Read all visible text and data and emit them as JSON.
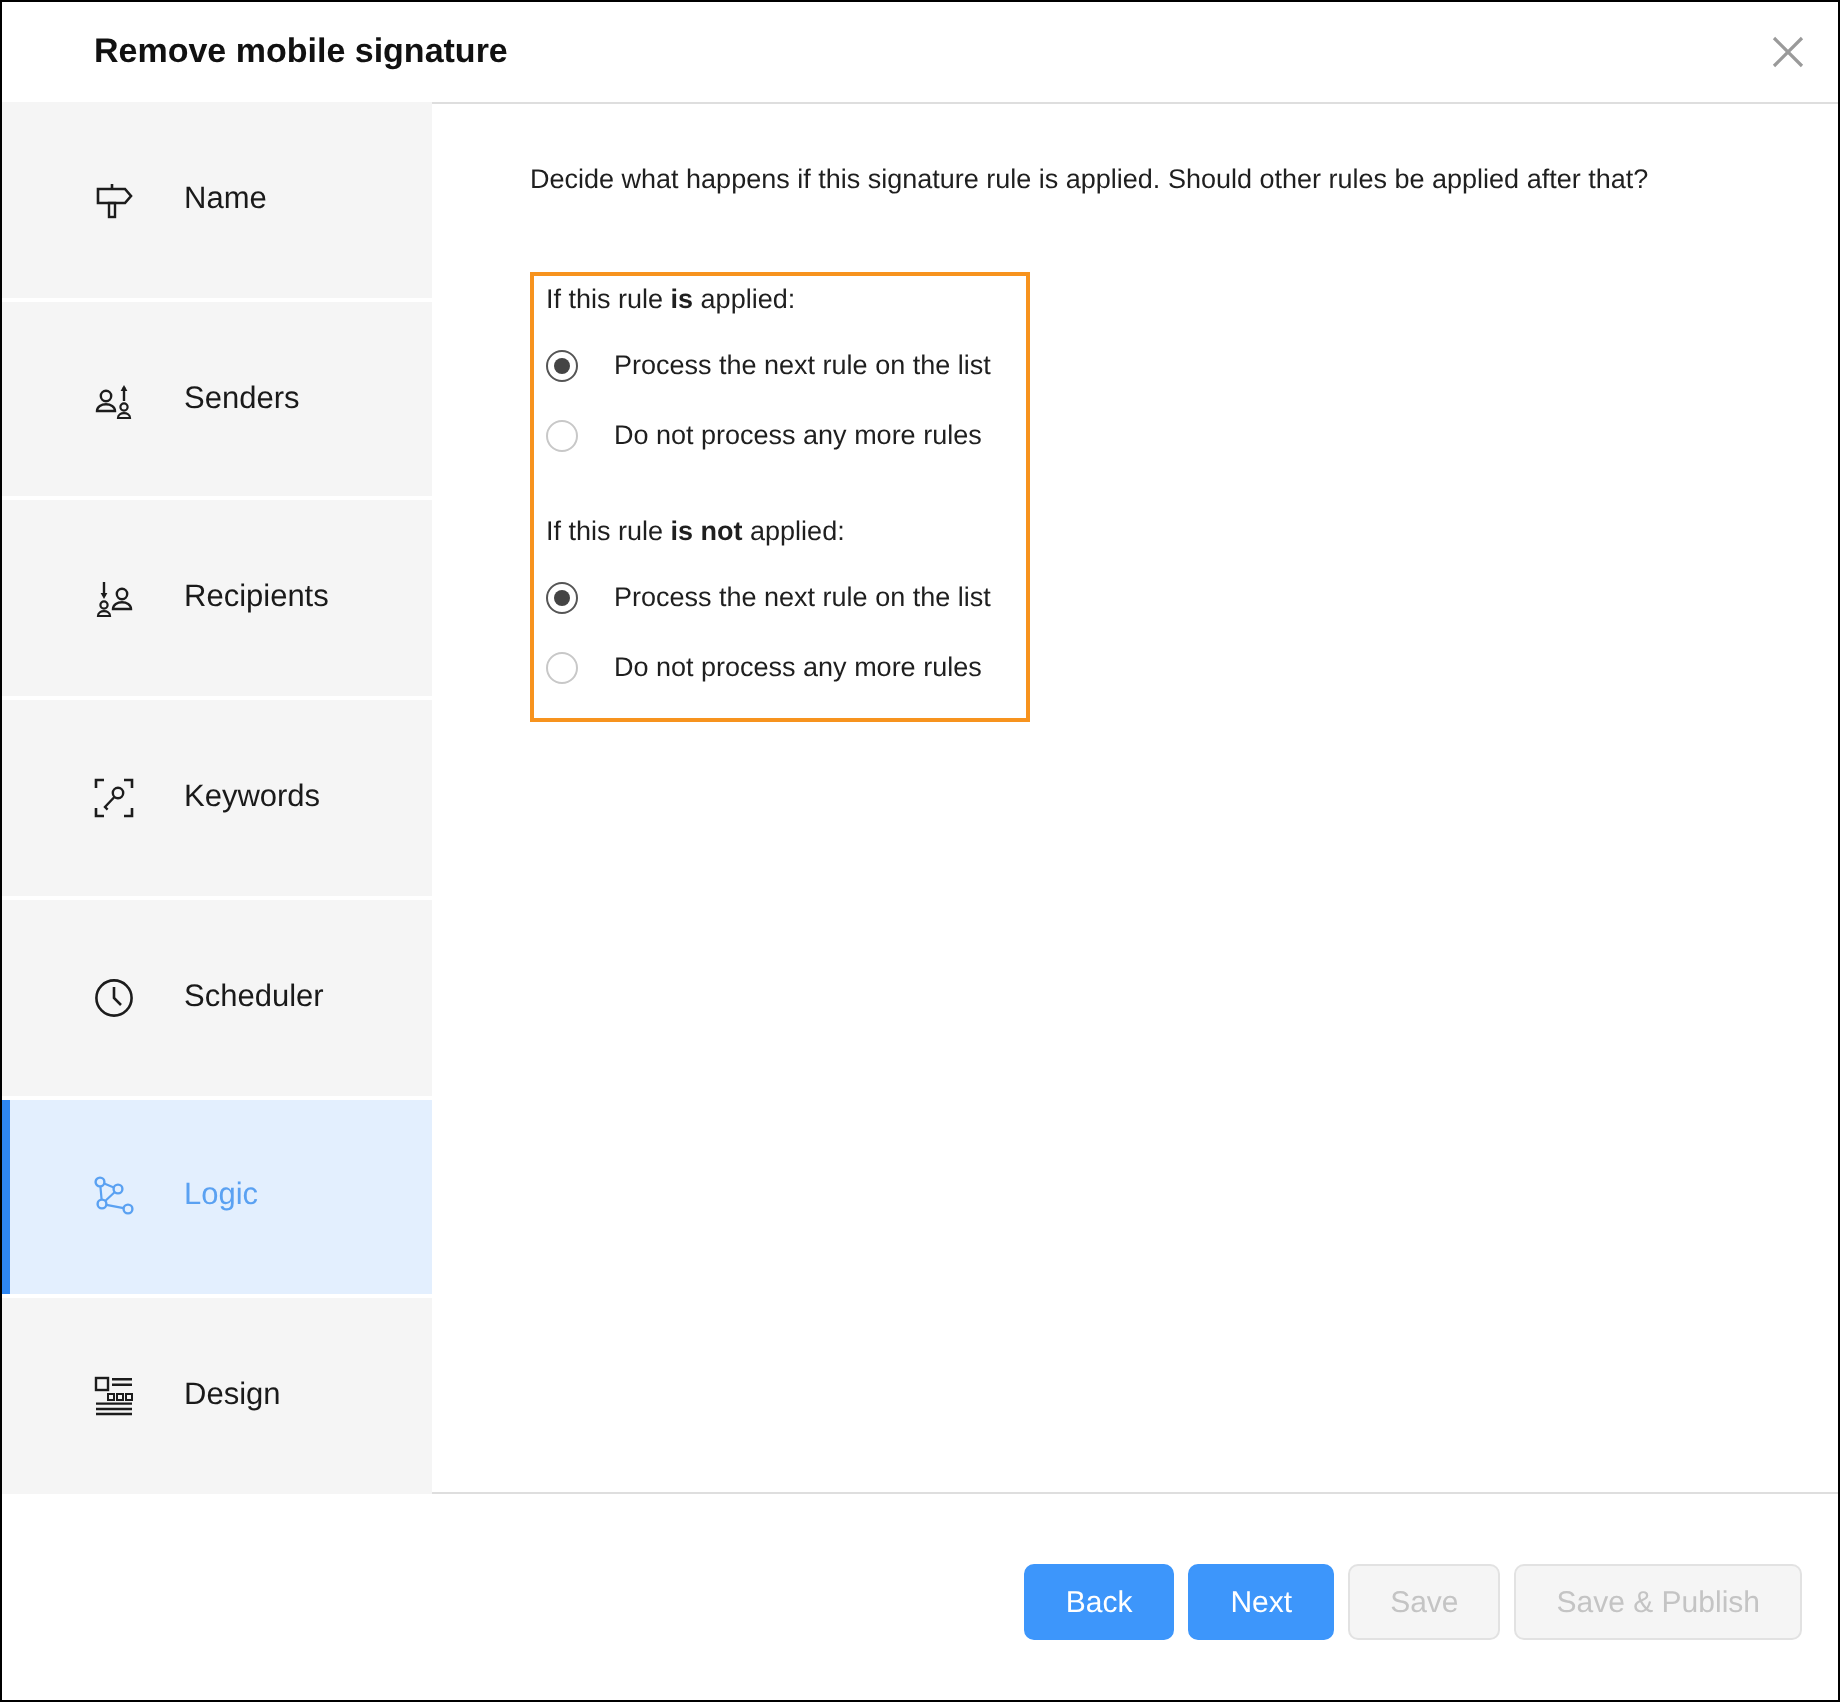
{
  "window": {
    "title": "Remove mobile signature"
  },
  "sidebar": {
    "items": [
      {
        "label": "Name",
        "selected": false
      },
      {
        "label": "Senders",
        "selected": false
      },
      {
        "label": "Recipients",
        "selected": false
      },
      {
        "label": "Keywords",
        "selected": false
      },
      {
        "label": "Scheduler",
        "selected": false
      },
      {
        "label": "Logic",
        "selected": true
      },
      {
        "label": "Design",
        "selected": false
      }
    ]
  },
  "content": {
    "description": "Decide what happens if this signature rule is applied. Should other rules be applied after that?",
    "groups": [
      {
        "heading": "If this rule **is** applied:",
        "options": [
          {
            "label": "Process the next rule on the list",
            "selected": true
          },
          {
            "label": "Do not process any more rules",
            "selected": false
          }
        ]
      },
      {
        "heading": "If this rule **is not** applied:",
        "options": [
          {
            "label": "Process the next rule on the list",
            "selected": true
          },
          {
            "label": "Do not process any more rules",
            "selected": false
          }
        ]
      }
    ]
  },
  "footer": {
    "buttons": [
      {
        "label": "Back",
        "disabled": false
      },
      {
        "label": "Next",
        "disabled": false
      },
      {
        "label": "Save",
        "disabled": true
      },
      {
        "label": "Save & Publish",
        "disabled": true
      }
    ]
  }
}
